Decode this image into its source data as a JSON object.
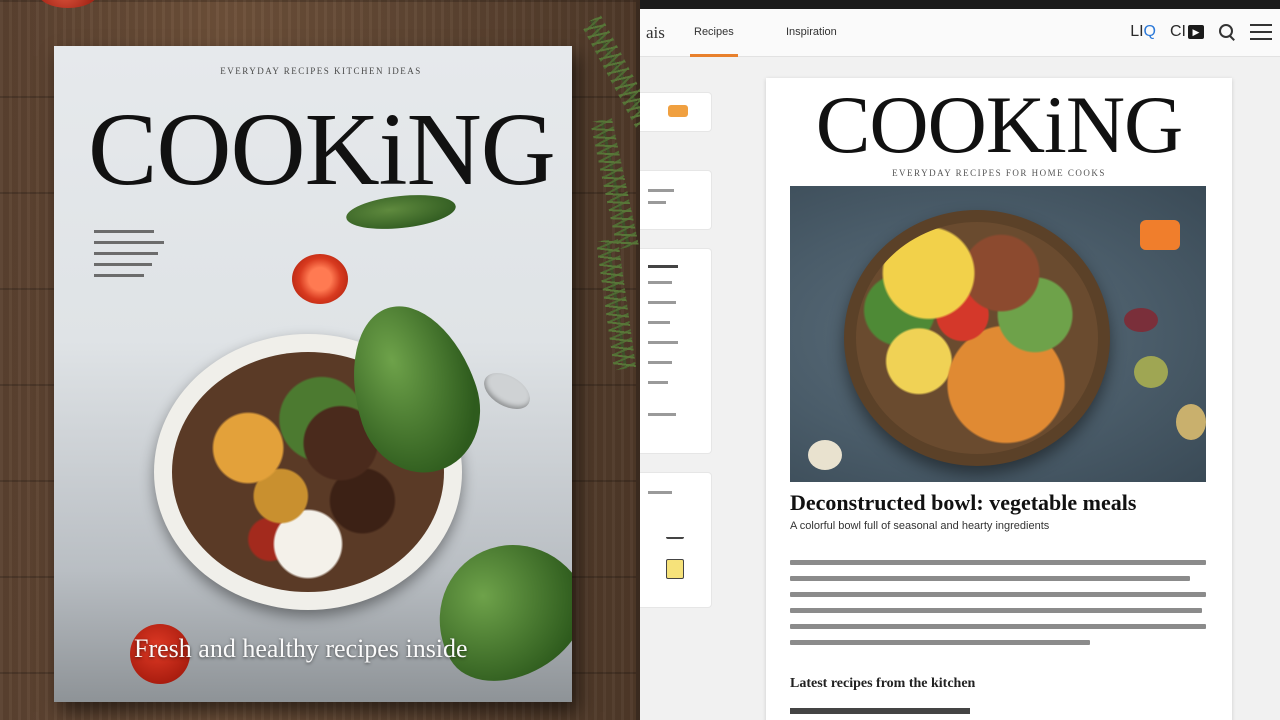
{
  "magazine": {
    "tagline": "EVERYDAY RECIPES KITCHEN IDEAS",
    "title": "COOKiNG",
    "caption": "Fresh and healthy recipes inside"
  },
  "website": {
    "brand": "ais",
    "tabs": [
      {
        "label": "Recipes",
        "active": true
      },
      {
        "label": "Inspiration"
      }
    ],
    "header_right": {
      "text": "LI",
      "accent": "Q",
      "text2": "CI",
      "box_glyph": "▶"
    },
    "article": {
      "title": "COOKiNG",
      "tagline": "EVERYDAY RECIPES FOR HOME COOKS",
      "headline": "Deconstructed bowl: vegetable meals",
      "subheadline": "A colorful bowl full of seasonal and hearty ingredients",
      "section": "Latest recipes from the kitchen"
    }
  },
  "colors": {
    "accent": "#e8802c",
    "link_blue": "#2a78d8",
    "tomato_red": "#d83a1f"
  }
}
